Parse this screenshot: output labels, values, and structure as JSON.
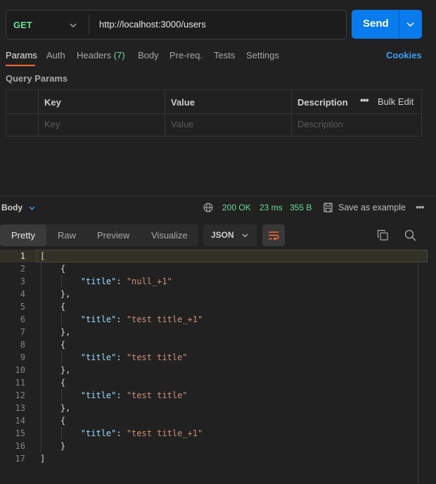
{
  "request": {
    "method": "GET",
    "url": "http://localhost:3000/users",
    "send_label": "Send"
  },
  "request_tabs": [
    {
      "label": "Params"
    },
    {
      "label": "Auth"
    },
    {
      "label": "Headers"
    },
    {
      "label": "Body"
    },
    {
      "label": "Pre-req."
    },
    {
      "label": "Tests"
    },
    {
      "label": "Settings"
    }
  ],
  "headers_count": "(7)",
  "cookies_label": "Cookies",
  "query_params": {
    "title": "Query Params",
    "headers": [
      "Key",
      "Value",
      "Description"
    ],
    "bulk_edit": "Bulk Edit",
    "placeholders": [
      "Key",
      "Value",
      "Description"
    ]
  },
  "response": {
    "body_label": "Body",
    "status": "200 OK",
    "time": "23 ms",
    "size": "355 B",
    "save_label": "Save as example",
    "view_tabs": [
      "Pretty",
      "Raw",
      "Preview",
      "Visualize"
    ],
    "format": "JSON"
  },
  "code_lines": [
    {
      "n": "1",
      "text": "["
    },
    {
      "n": "2",
      "text": "    {"
    },
    {
      "n": "3",
      "key": "\"title\"",
      "value": "\"null_+1\""
    },
    {
      "n": "4",
      "text": "    },"
    },
    {
      "n": "5",
      "text": "    {"
    },
    {
      "n": "6",
      "key": "\"title\"",
      "value": "\"test title_+1\""
    },
    {
      "n": "7",
      "text": "    },"
    },
    {
      "n": "8",
      "text": "    {"
    },
    {
      "n": "9",
      "key": "\"title\"",
      "value": "\"test title\""
    },
    {
      "n": "10",
      "text": "    },"
    },
    {
      "n": "11",
      "text": "    {"
    },
    {
      "n": "12",
      "key": "\"title\"",
      "value": "\"test title\""
    },
    {
      "n": "13",
      "text": "    },"
    },
    {
      "n": "14",
      "text": "    {"
    },
    {
      "n": "15",
      "key": "\"title\"",
      "value": "\"test title_+1\""
    },
    {
      "n": "16",
      "text": "    }"
    },
    {
      "n": "17",
      "text": "]"
    }
  ],
  "colors": {
    "accent": "#ff6c37",
    "send": "#097bed",
    "success": "#6bdd9a",
    "link": "#3d9ef5"
  },
  "icons": [
    "chevron-down-icon",
    "globe-icon",
    "save-icon",
    "more-icon",
    "wrap-icon",
    "copy-icon",
    "search-icon"
  ]
}
